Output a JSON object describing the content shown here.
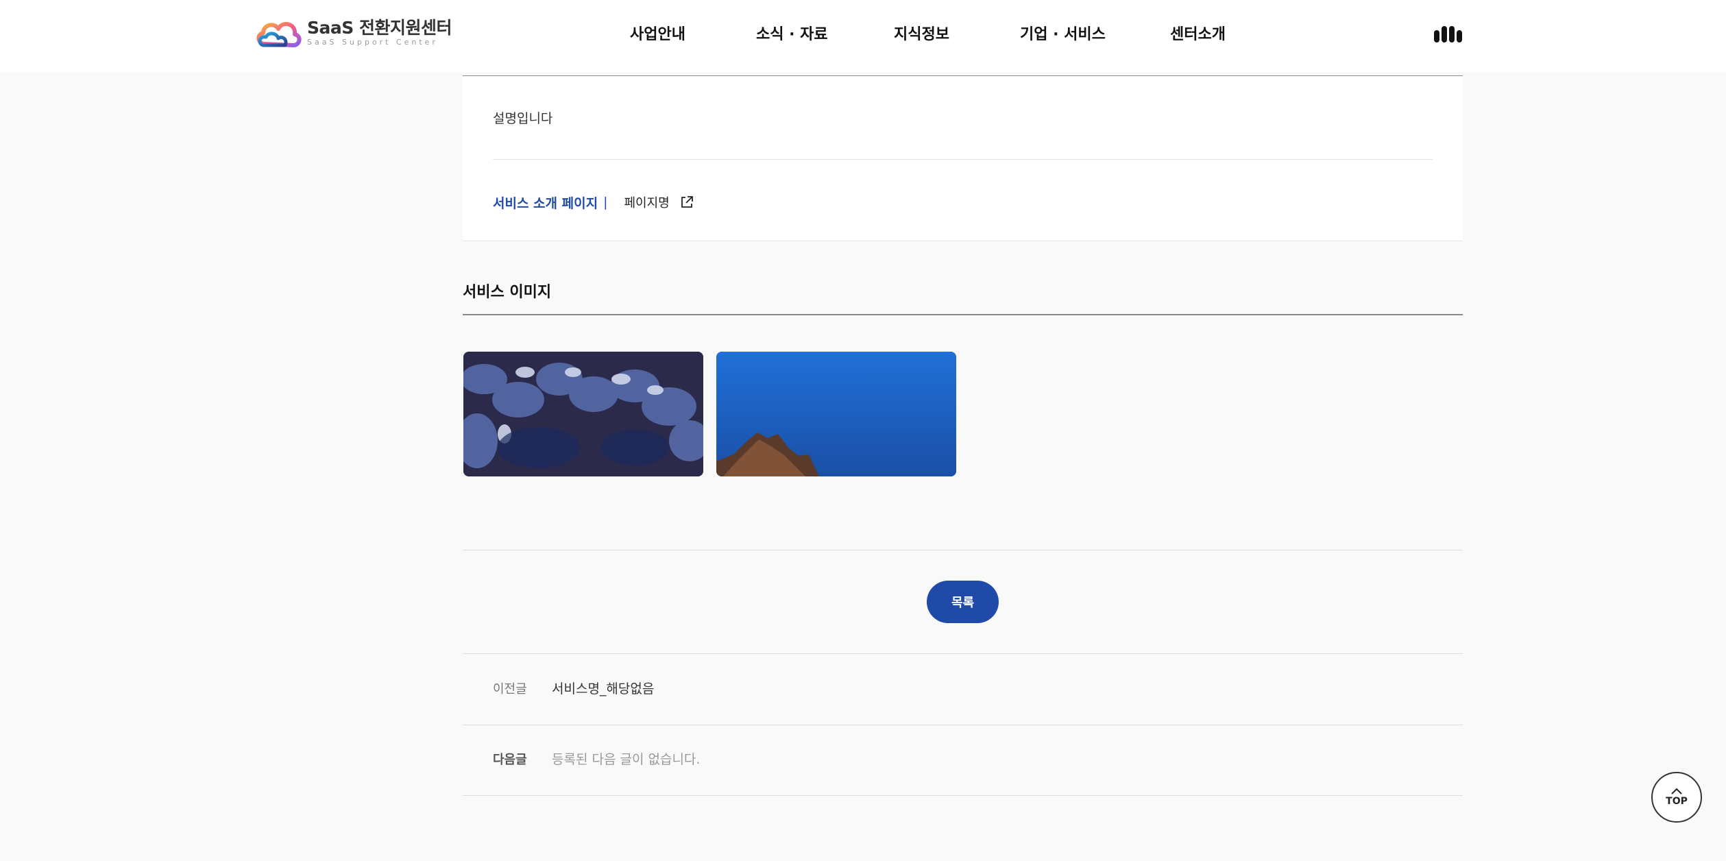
{
  "header": {
    "logo_title": "SaaS 전환지원센터",
    "logo_subtitle": "SaaS Support Center",
    "nav": [
      {
        "label": "사업안내"
      },
      {
        "label": "소식 · 자료"
      },
      {
        "label": "지식정보"
      },
      {
        "label": "기업 · 서비스"
      },
      {
        "label": "센터소개"
      }
    ],
    "menu_icon": "menu-bars-icon"
  },
  "detail": {
    "description": "설명입니다",
    "link_label": "서비스 소개 페이지",
    "link_separator": "|",
    "link_value": "페이지명",
    "link_icon": "external-link-icon"
  },
  "images_section": {
    "title": "서비스 이미지"
  },
  "actions": {
    "list_label": "목록"
  },
  "post_nav": {
    "prev_label": "이전글",
    "prev_title": "서비스명_해당없음",
    "next_label": "다음글",
    "next_title": "등록된 다음 글이 없습니다."
  },
  "top_button": {
    "label": "TOP",
    "icon": "chevron-up-icon"
  },
  "colors": {
    "primary": "#1f4aa8",
    "background": "#f9f9f9"
  }
}
